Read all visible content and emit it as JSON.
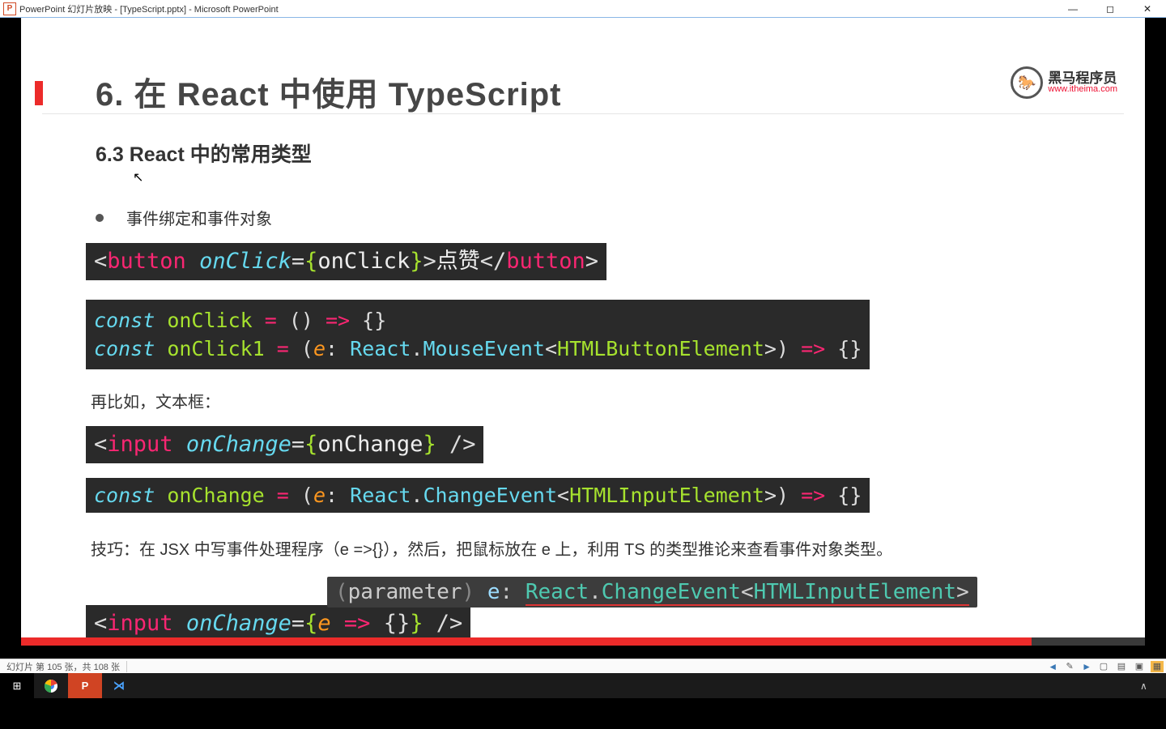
{
  "window": {
    "title": "PowerPoint 幻灯片放映 - [TypeScript.pptx] - Microsoft PowerPoint"
  },
  "slide": {
    "heading": "6. 在 React 中使用 TypeScript",
    "logo_cn": "黑马程序员",
    "logo_url": "www.itheima.com",
    "subheading": "6.3 React 中的常用类型",
    "bullet1": "事件绑定和事件对象",
    "code1": {
      "open_tag": "button",
      "attr": "onClick",
      "handler": "onClick",
      "text": "点赞",
      "close_tag": "button"
    },
    "code2": {
      "l1_kw": "const",
      "l1_name": "onClick",
      "l1_eq": " = ",
      "l1_params": "()",
      "l1_arrow": " => ",
      "l1_body": "{}",
      "l2_kw": "const",
      "l2_name": "onClick1",
      "l2_eq": " = ",
      "l2_open": "(",
      "l2_param": "e",
      "l2_colon": ": ",
      "l2_ns": "React",
      "l2_dot": ".",
      "l2_evt": "MouseEvent",
      "l2_lt": "<",
      "l2_generic": "HTMLButtonElement",
      "l2_gt": ">",
      "l2_close": ")",
      "l2_arrow": " => ",
      "l2_body": "{}"
    },
    "plain1": "再比如，文本框：",
    "code3": {
      "open_tag": "input",
      "attr": "onChange",
      "handler": "onChange",
      "selfclose": " />"
    },
    "code4": {
      "kw": "const",
      "name": "onChange",
      "eq": " = ",
      "open": "(",
      "param": "e",
      "colon": ": ",
      "ns": "React",
      "dot": ".",
      "evt": "ChangeEvent",
      "lt": "<",
      "generic": "HTMLInputElement",
      "gt": ">",
      "close": ")",
      "arrow": " => ",
      "body": "{}"
    },
    "plain2": "技巧：在 JSX 中写事件处理程序（e =>{}），然后，把鼠标放在 e 上，利用 TS 的类型推论来查看事件对象类型。",
    "tooltip": {
      "paren_open": "(",
      "label": "parameter",
      "paren_close": ")",
      "space": " ",
      "e": "e",
      "colon": ": ",
      "ns": "React",
      "dot": ".",
      "evt": "ChangeEvent",
      "lt": "<",
      "generic": "HTMLInputElement",
      "gt": ">"
    },
    "code5": {
      "open_tag": "input",
      "attr": "onChange",
      "brace_open": "{",
      "param": "e",
      "arrow": " => ",
      "body": "{}",
      "brace_close": "}",
      "selfclose": " />"
    }
  },
  "statusbar": {
    "text": "幻灯片 第 105 张，共 108 张"
  }
}
